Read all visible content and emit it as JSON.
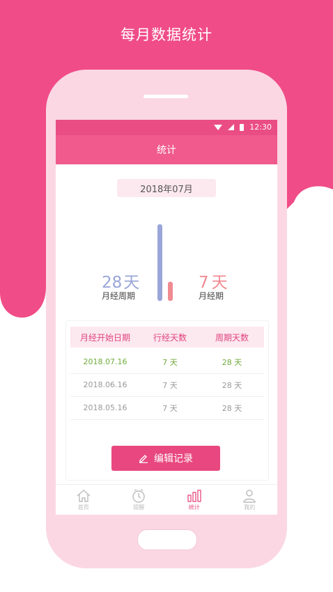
{
  "promo_title": "每月数据统计",
  "status_bar": {
    "time": "12:30"
  },
  "header": {
    "title": "统计"
  },
  "month": "2018年07月",
  "chart_data": {
    "type": "bar",
    "categories": [
      "月经周期",
      "月经期"
    ],
    "values": [
      28,
      7
    ],
    "colors": [
      "#9aa6d8",
      "#f08b92"
    ]
  },
  "stats": {
    "cycle": {
      "value": "28",
      "unit": "天",
      "label": "月经周期",
      "color": "#9aa6d8"
    },
    "period": {
      "value": "7",
      "unit": "天",
      "label": "月经期",
      "color": "#f08b92"
    }
  },
  "table": {
    "headers": [
      "月经开始日期",
      "行经天数",
      "周期天数"
    ],
    "rows": [
      {
        "date": "2018.07.16",
        "period_days": "7 天",
        "cycle_days": "28 天"
      },
      {
        "date": "2018.06.16",
        "period_days": "7 天",
        "cycle_days": "28 天"
      },
      {
        "date": "2018.05.16",
        "period_days": "7 天",
        "cycle_days": "28 天"
      }
    ]
  },
  "edit_button": {
    "label": "编辑记录",
    "icon": "pencil-icon"
  },
  "tabs": [
    {
      "label": "首页",
      "icon": "home-icon"
    },
    {
      "label": "提醒",
      "icon": "clock-icon"
    },
    {
      "label": "统计",
      "icon": "bar-chart-icon",
      "active": true
    },
    {
      "label": "我的",
      "icon": "user-icon"
    }
  ],
  "colors": {
    "brand": "#f04c87",
    "accent": "#e8487f",
    "current_row": "#6fab3a"
  }
}
